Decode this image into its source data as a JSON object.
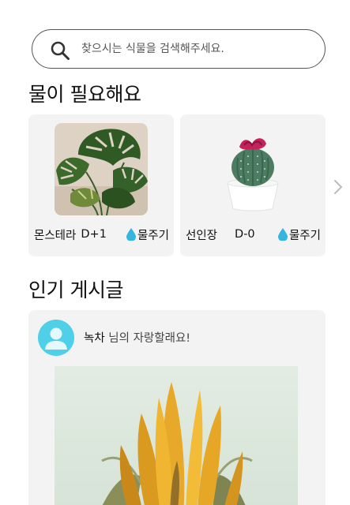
{
  "search": {
    "placeholder": "찾으시는 식물을 검색해주세요.",
    "icon": "search-icon"
  },
  "water_section": {
    "title": "물이 필요해요",
    "plants": [
      {
        "name": "몬스테라",
        "dday": "D+1",
        "water_label": "물주기",
        "image": "monstera-plant-image"
      },
      {
        "name": "선인장",
        "dday": "D-0",
        "water_label": "물주기",
        "image": "cactus-plant-image"
      }
    ],
    "next_icon": "chevron-right-icon"
  },
  "popular_section": {
    "title": "인기 게시글",
    "post": {
      "user": "녹차",
      "suffix": " 님의 자랑할래요!",
      "avatar_icon": "user-avatar-icon",
      "image": "sunflower-bud-image"
    }
  },
  "colors": {
    "card_bg": "#f3f3f3",
    "water_drop": "#35b6e0",
    "avatar_bg": "#4fd0e8",
    "search_border": "#555555"
  }
}
